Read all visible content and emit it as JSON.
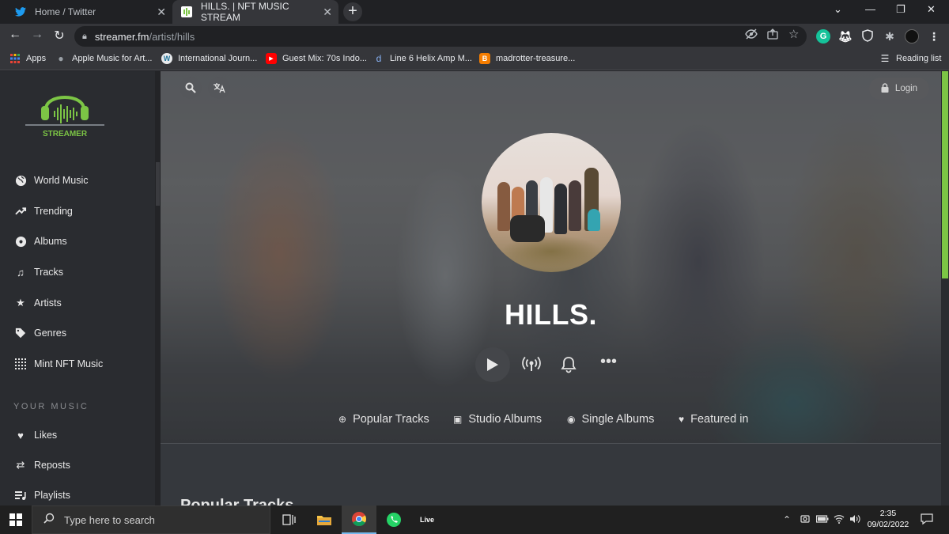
{
  "browser": {
    "tabs": [
      {
        "title": "Home / Twitter",
        "active": false
      },
      {
        "title": "HILLS. | NFT MUSIC STREAM",
        "active": true
      }
    ],
    "url_host": "streamer.fm",
    "url_path": "/artist/hills",
    "bookmarks": [
      {
        "label": "Apps",
        "icon": "apps-grid-icon"
      },
      {
        "label": "Apple Music for Art...",
        "icon": "apple-icon"
      },
      {
        "label": "International Journ...",
        "icon": "wordpress-icon"
      },
      {
        "label": "Guest Mix: 70s Indo...",
        "icon": "youtube-icon"
      },
      {
        "label": "Line 6 Helix Amp M...",
        "icon": "d-icon"
      },
      {
        "label": "madrotter-treasure...",
        "icon": "blogger-icon"
      }
    ],
    "reading_list": "Reading list"
  },
  "sidebar": {
    "logo_text": "STREAMER",
    "nav": [
      {
        "label": "World Music",
        "icon": "globe-icon"
      },
      {
        "label": "Trending",
        "icon": "trending-icon"
      },
      {
        "label": "Albums",
        "icon": "disc-icon"
      },
      {
        "label": "Tracks",
        "icon": "music-note-icon"
      },
      {
        "label": "Artists",
        "icon": "star-icon"
      },
      {
        "label": "Genres",
        "icon": "tag-icon"
      },
      {
        "label": "Mint NFT Music",
        "icon": "grid-dots-icon"
      }
    ],
    "section_heading": "YOUR MUSIC",
    "your_music": [
      {
        "label": "Likes",
        "icon": "heart-icon"
      },
      {
        "label": "Reposts",
        "icon": "repost-icon"
      },
      {
        "label": "Playlists",
        "icon": "playlist-icon"
      }
    ]
  },
  "hero": {
    "login_label": "Login",
    "artist_name": "HILLS.",
    "tabs": [
      {
        "label": "Popular Tracks",
        "icon": "plus-circle-icon"
      },
      {
        "label": "Studio Albums",
        "icon": "albums-icon"
      },
      {
        "label": "Single Albums",
        "icon": "disc-icon"
      },
      {
        "label": "Featured in",
        "icon": "heart-icon"
      }
    ],
    "section_peek": "Popular Tracks"
  },
  "taskbar": {
    "search_placeholder": "Type here to search",
    "time": "2:35",
    "date": "09/02/2022",
    "live_label": "Live"
  },
  "colors": {
    "accent": "#7cc545",
    "sidebar_bg": "#2a2c30"
  }
}
